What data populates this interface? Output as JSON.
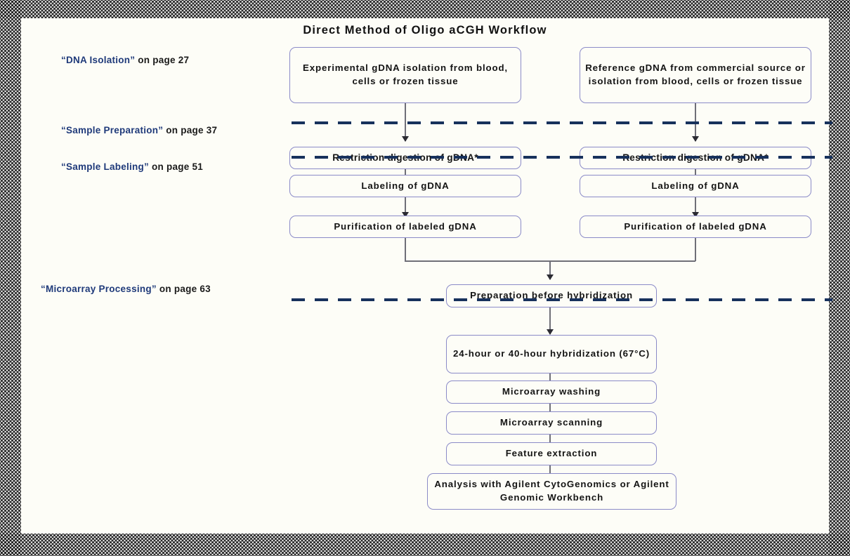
{
  "diagram": {
    "title": "Direct Method of Oligo aCGH Workflow",
    "accent_box_border": "#8b8bc8",
    "accent_link_color": "#1f3a7a",
    "dash_color": "#17315c",
    "connector_color": "#6f6f78"
  },
  "section_refs": [
    {
      "quoted": "“DNA Isolation”",
      "page": "on page 27"
    },
    {
      "quoted": "“Sample Preparation”",
      "page": "on page 37"
    },
    {
      "quoted": "“Sample Labeling”",
      "page": "on page 51"
    },
    {
      "quoted": "“Microarray Processing”",
      "page": "on page 63"
    }
  ],
  "left_column": [
    {
      "label": "Experimental gDNA isolation from blood, cells or frozen tissue"
    },
    {
      "label": "Restriction digestion of gDNA*"
    },
    {
      "label": "Labeling of gDNA"
    },
    {
      "label": "Purification of labeled gDNA"
    }
  ],
  "right_column": [
    {
      "label": "Reference gDNA from commercial source or isolation from blood, cells or frozen tissue"
    },
    {
      "label": "Restriction digestion of gDNA*"
    },
    {
      "label": "Labeling of gDNA"
    },
    {
      "label": "Purification of labeled gDNA"
    }
  ],
  "merged_column": [
    {
      "label": "Preparation before hybridization"
    },
    {
      "label": "24-hour or 40-hour hybridization (67°C)"
    },
    {
      "label": "Microarray washing"
    },
    {
      "label": "Microarray scanning"
    },
    {
      "label": "Feature extraction"
    },
    {
      "label": "Analysis with Agilent CytoGenomics  or Agilent Genomic Workbench"
    }
  ]
}
